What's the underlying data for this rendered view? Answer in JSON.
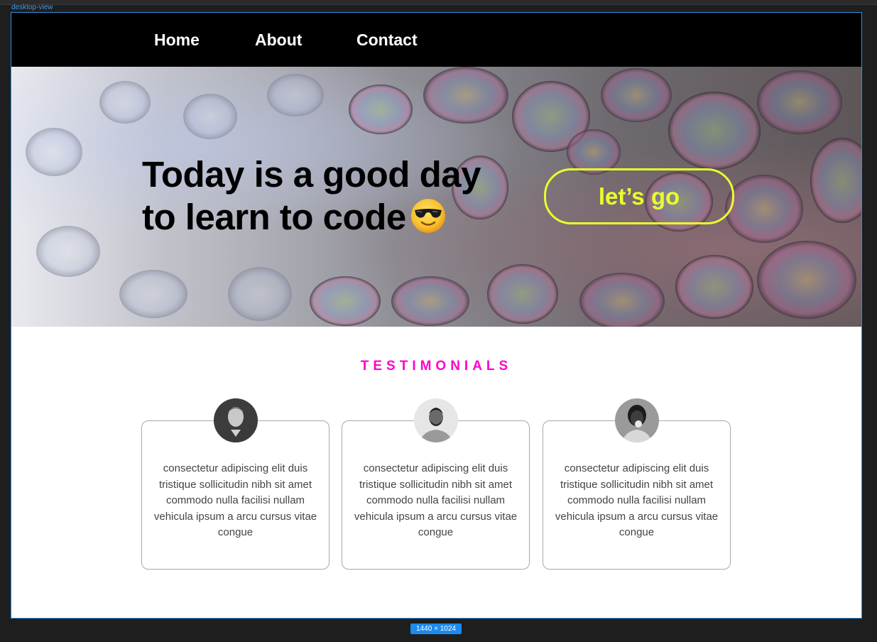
{
  "frame": {
    "label": "desktop-view",
    "size_badge": "1440 × 1024"
  },
  "nav": {
    "items": [
      {
        "label": "Home"
      },
      {
        "label": "About"
      },
      {
        "label": "Contact"
      }
    ]
  },
  "hero": {
    "title_line1": "Today is a good day",
    "title_line2": "to learn to code",
    "emoji": "smiling-face-with-sunglasses-icon",
    "cta_label": "let’s go"
  },
  "testimonials": {
    "title": "TESTIMONIALS",
    "cards": [
      {
        "text": "consectetur adipiscing elit duis tristique sollicitudin nibh sit amet commodo nulla facilisi nullam vehicula ipsum a arcu cursus vitae congue",
        "avatar": "avatar-man-1"
      },
      {
        "text": "consectetur adipiscing elit duis tristique sollicitudin nibh sit amet commodo nulla facilisi nullam vehicula ipsum a arcu cursus vitae congue",
        "avatar": "avatar-man-2"
      },
      {
        "text": "consectetur adipiscing elit duis tristique sollicitudin nibh sit amet commodo nulla facilisi nullam vehicula ipsum a arcu cursus vitae congue",
        "avatar": "avatar-woman"
      }
    ]
  },
  "colors": {
    "nav_bg": "#000000",
    "cta": "#eaff2a",
    "section_title": "#ff00cc",
    "frame_border": "#2f8fe0"
  }
}
